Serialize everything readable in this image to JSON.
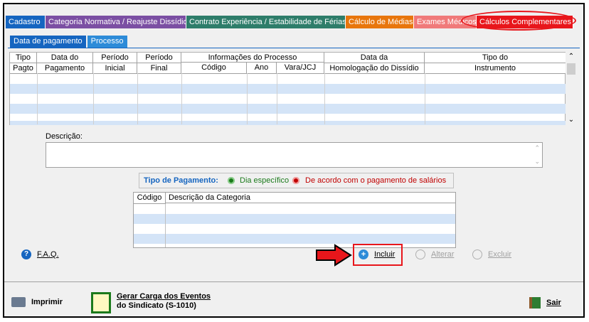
{
  "top_tabs": [
    {
      "label": "Cadastro",
      "color": "#1565c0"
    },
    {
      "label": "Categoria Normativa / Reajuste Dissídio",
      "color": "#7b4fa3"
    },
    {
      "label": "Contrato Experiência / Estabilidade de Férias",
      "color": "#2e7d6a"
    },
    {
      "label": "Cálculo de Médias",
      "color": "#e8760d"
    },
    {
      "label": "Exames Médicos",
      "color": "#f07a7a"
    },
    {
      "label": "Cálculos Complementares",
      "color": "#e8161b"
    }
  ],
  "sub_tabs": [
    {
      "label": "Data de pagamento",
      "color": "#1565c0"
    },
    {
      "label": "Processo",
      "color": "#2d8bd8"
    }
  ],
  "grid": {
    "group_header": "Informações do Processo",
    "columns": [
      {
        "l1": "Tipo",
        "l2": "Pagto"
      },
      {
        "l1": "Data do",
        "l2": "Pagamento"
      },
      {
        "l1": "Período",
        "l2": "Inicial"
      },
      {
        "l1": "Período",
        "l2": "Final"
      },
      {
        "l1": "",
        "l2": "Código"
      },
      {
        "l1": "",
        "l2": "Ano"
      },
      {
        "l1": "",
        "l2": "Vara/JCJ"
      },
      {
        "l1": "Data da",
        "l2": "Homologação do Dissídio"
      },
      {
        "l1": "Tipo do",
        "l2": "Instrumento"
      }
    ]
  },
  "descricao_label": "Descrição:",
  "tipo_pagamento": {
    "label": "Tipo de Pagamento:",
    "option1": "Dia específico",
    "option2": "De acordo com o pagamento de salários"
  },
  "categoria_grid": {
    "col1": "Código",
    "col2": "Descrição da Categoria"
  },
  "buttons": {
    "faq": "F.A.Q.",
    "incluir": "Incluir",
    "alterar": "Alterar",
    "excluir": "Excluir",
    "imprimir": "Imprimir",
    "gerar_l1": "Gerar Carga dos Eventos",
    "gerar_l2": "do Sindicato (S-1010)",
    "sair": "Sair"
  },
  "colors": {
    "row_alt": "#d4e4f7",
    "highlight": "#e8161b",
    "blue_label": "#1565c0"
  }
}
